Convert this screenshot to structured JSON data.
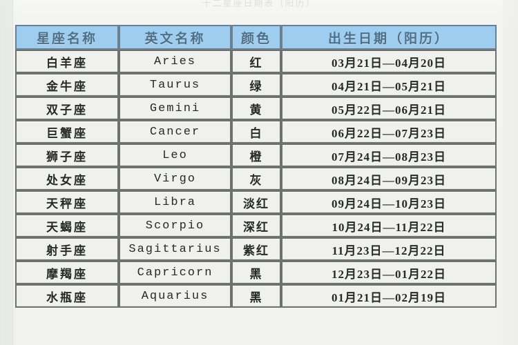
{
  "caption": {
    "text": "十二星座日期表（阳历）"
  },
  "table": {
    "headers": {
      "name": "星座名称",
      "english": "英文名称",
      "color": "颜色",
      "date": "出生日期（阳历）"
    },
    "colors": {
      "header_background": "#9ecdf0",
      "header_text": "#4f6f86",
      "cell_background": "#f0f1ee",
      "border": "#6e716e",
      "page_background": "#f2f3f0"
    },
    "rows": [
      {
        "name": "白羊座",
        "english": "Aries",
        "color": "红",
        "date": "03月21日—04月20日"
      },
      {
        "name": "金牛座",
        "english": "Taurus",
        "color": "绿",
        "date": "04月21日—05月21日"
      },
      {
        "name": "双子座",
        "english": "Gemini",
        "color": "黄",
        "date": "05月22日—06月21日"
      },
      {
        "name": "巨蟹座",
        "english": "Cancer",
        "color": "白",
        "date": "06月22日—07月23日"
      },
      {
        "name": "狮子座",
        "english": "Leo",
        "color": "橙",
        "date": "07月24日—08月23日"
      },
      {
        "name": "处女座",
        "english": "Virgo",
        "color": "灰",
        "date": "08月24日—09月23日"
      },
      {
        "name": "天秤座",
        "english": "Libra",
        "color": "淡红",
        "date": "09月24日—10月23日"
      },
      {
        "name": "天蝎座",
        "english": "Scorpio",
        "color": "深红",
        "date": "10月24日—11月22日"
      },
      {
        "name": "射手座",
        "english": "Sagittarius",
        "color": "紫红",
        "date": "11月23日—12月22日"
      },
      {
        "name": "摩羯座",
        "english": "Capricorn",
        "color": "黑",
        "date": "12月23日—01月22日"
      },
      {
        "name": "水瓶座",
        "english": "Aquarius",
        "color": "黑",
        "date": "01月21日—02月19日"
      }
    ]
  }
}
